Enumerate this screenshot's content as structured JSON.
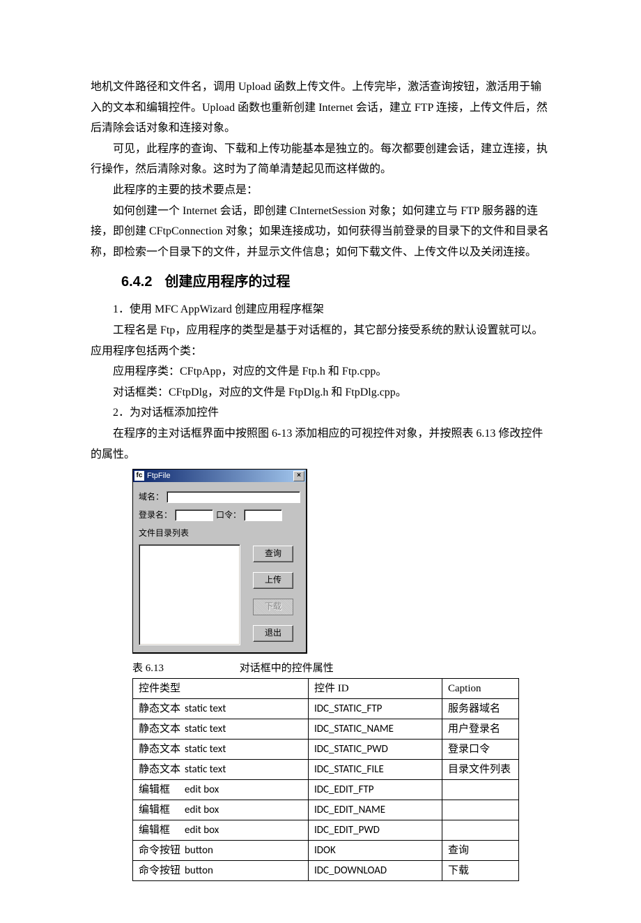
{
  "body": {
    "p1": "地机文件路径和文件名，调用 Upload 函数上传文件。上传完毕，激活查询按钮，激活用于输入的文本和编辑控件。Upload 函数也重新创建 Internet 会话，建立 FTP 连接，上传文件后，然后清除会话对象和连接对象。",
    "p2": "可见，此程序的查询、下载和上传功能基本是独立的。每次都要创建会话，建立连接，执行操作，然后清除对象。这时为了简单清楚起见而这样做的。",
    "p3": "此程序的主要的技术要点是：",
    "p4": "如何创建一个 Internet 会话，即创建 CInternetSession 对象；如何建立与 FTP 服务器的连接，即创建 CFtpConnection 对象；如果连接成功，如何获得当前登录的目录下的文件和目录名称，即检索一个目录下的文件，并显示文件信息；如何下载文件、上传文件以及关闭连接。"
  },
  "heading": {
    "num": "6.4.2",
    "title": "创建应用程序的过程"
  },
  "steps": {
    "s1": "1．使用 MFC AppWizard 创建应用程序框架",
    "s1a": "工程名是 Ftp，应用程序的类型是基于对话框的，其它部分接受系统的默认设置就可以。应用程序包括两个类：",
    "s1b": "应用程序类：CFtpApp，对应的文件是 Ftp.h 和 Ftp.cpp。",
    "s1c": "对话框类：CFtpDlg，对应的文件是 FtpDlg.h 和 FtpDlg.cpp。",
    "s2": "2．为对话框添加控件",
    "s2a": "在程序的主对话框界面中按照图 6-13 添加相应的可视控件对象，并按照表 6.13 修改控件的属性。"
  },
  "dialog": {
    "title": "FtpFile",
    "close": "×",
    "icon_glyph": "fc",
    "labels": {
      "domain": "域名：",
      "login": "登录名：",
      "password": "口令：",
      "filelist": "文件目录列表"
    },
    "buttons": {
      "query": "查询",
      "upload": "上传",
      "download": "下载",
      "exit": "退出"
    }
  },
  "table": {
    "caption_left": "表 6.13",
    "caption_right": "对话框中的控件属性",
    "headers": {
      "c1": "控件类型",
      "c2": "控件 ID",
      "c3": "Caption"
    },
    "rows": [
      {
        "type_cn": "静态文本",
        "type_en": "static text",
        "id": "IDC_STATIC_FTP",
        "cap": "服务器域名"
      },
      {
        "type_cn": "静态文本",
        "type_en": "static text",
        "id": "IDC_STATIC_NAME",
        "cap": "用户登录名"
      },
      {
        "type_cn": "静态文本",
        "type_en": "static text",
        "id": "IDC_STATIC_PWD",
        "cap": "登录口令"
      },
      {
        "type_cn": "静态文本",
        "type_en": "static text",
        "id": "IDC_STATIC_FILE",
        "cap": "目录文件列表"
      },
      {
        "type_cn": "编辑框",
        "type_en": "edit box",
        "id": "IDC_EDIT_FTP",
        "cap": ""
      },
      {
        "type_cn": "编辑框",
        "type_en": "edit box",
        "id": "IDC_EDIT_NAME",
        "cap": ""
      },
      {
        "type_cn": "编辑框",
        "type_en": "edit box",
        "id": "IDC_EDIT_PWD",
        "cap": ""
      },
      {
        "type_cn": "命令按钮",
        "type_en": "button",
        "id": "IDOK",
        "cap": "查询"
      },
      {
        "type_cn": "命令按钮",
        "type_en": "button",
        "id": "IDC_DOWNLOAD",
        "cap": "下载"
      }
    ]
  }
}
